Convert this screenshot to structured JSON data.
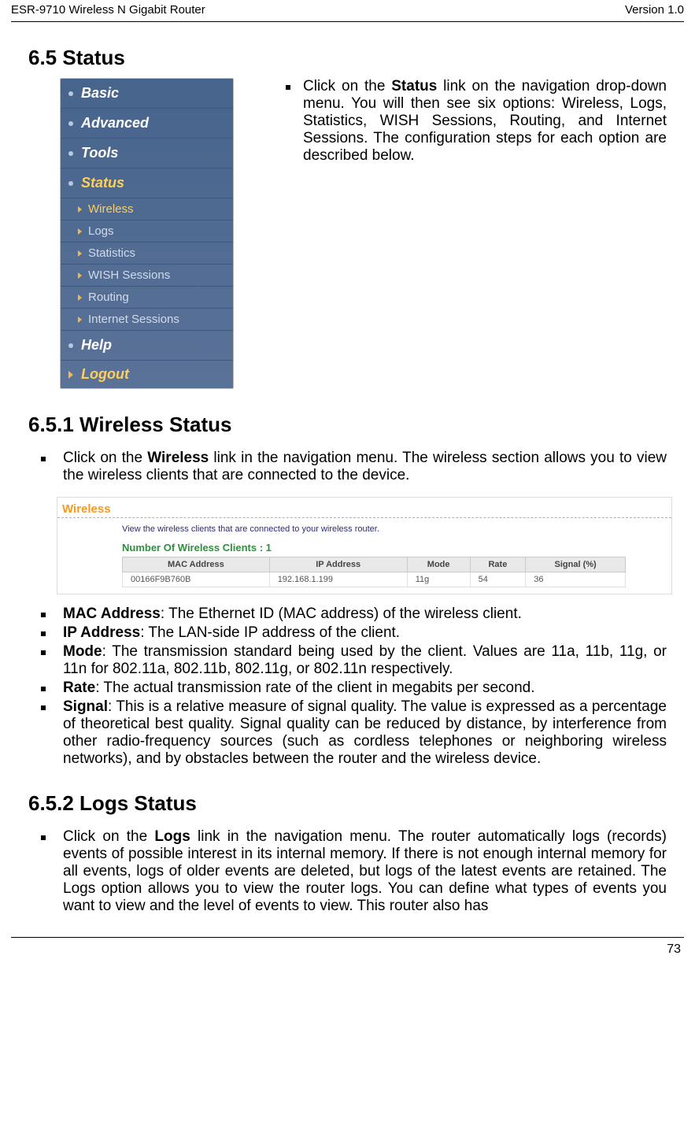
{
  "header": {
    "left": "ESR-9710 Wireless N Gigabit Router",
    "right": "Version 1.0"
  },
  "footer": {
    "page_number": "73"
  },
  "section_6_5": {
    "title": "6.5  Status",
    "description_prefix": "Click on the ",
    "description_bold": "Status",
    "description_suffix": " link on the navigation drop-down menu. You will then see six options: Wireless, Logs, Statistics, WISH Sessions, Routing, and Internet Sessions. The configuration steps for each option are described below."
  },
  "nav": {
    "main": [
      {
        "label": "Basic",
        "active": false
      },
      {
        "label": "Advanced",
        "active": false
      },
      {
        "label": "Tools",
        "active": false
      },
      {
        "label": "Status",
        "active": true
      }
    ],
    "sub": [
      {
        "label": "Wireless",
        "active": true
      },
      {
        "label": "Logs",
        "active": false
      },
      {
        "label": "Statistics",
        "active": false
      },
      {
        "label": "WISH Sessions",
        "active": false
      },
      {
        "label": "Routing",
        "active": false
      },
      {
        "label": "Internet Sessions",
        "active": false
      }
    ],
    "help": {
      "label": "Help"
    },
    "logout": {
      "label": "Logout"
    }
  },
  "section_6_5_1": {
    "title": "6.5.1 Wireless Status",
    "intro_prefix": "Click on the ",
    "intro_bold": "Wireless",
    "intro_suffix": " link in the navigation menu. The wireless section allows you to view the wireless clients that are connected to the device."
  },
  "wireless_panel": {
    "heading": "Wireless",
    "description": "View the wireless clients that are connected to your wireless router.",
    "count_label": "Number Of Wireless Clients :  1",
    "columns": {
      "mac": "MAC Address",
      "ip": "IP Address",
      "mode": "Mode",
      "rate": "Rate",
      "signal": "Signal (%)"
    },
    "row": {
      "mac": "00166F9B760B",
      "ip": "192.168.1.199",
      "mode": "11g",
      "rate": "54",
      "signal": "36"
    }
  },
  "field_defs": {
    "mac": {
      "label": "MAC Address",
      "text": ": The Ethernet ID (MAC address) of the wireless client."
    },
    "ip": {
      "label": "IP Address",
      "text": ": The LAN-side IP address of the client."
    },
    "mode": {
      "label": "Mode",
      "text": ": The transmission standard being used by the client. Values are 11a, 11b, 11g, or 11n for 802.11a, 802.11b, 802.11g, or 802.11n respectively."
    },
    "rate": {
      "label": "Rate",
      "text": ": The actual transmission rate of the client in megabits per second."
    },
    "signal": {
      "label": "Signal",
      "text": ": This is a relative measure of signal quality. The value is expressed as a percentage of theoretical best quality. Signal quality can be reduced by distance, by interference from other radio-frequency sources (such as cordless telephones or neighboring wireless networks), and by obstacles between the router and the wireless device."
    }
  },
  "section_6_5_2": {
    "title": "6.5.2 Logs Status",
    "intro_prefix": "Click on the ",
    "intro_bold": "Logs",
    "intro_suffix": " link in the navigation menu. The router automatically logs (records) events of possible interest in its internal memory. If there is not enough internal memory for all events, logs of older events are deleted, but logs of the latest events are retained. The Logs option allows you to view the router logs. You can define what types of events you want to view and the level of events to view. This router also has"
  }
}
